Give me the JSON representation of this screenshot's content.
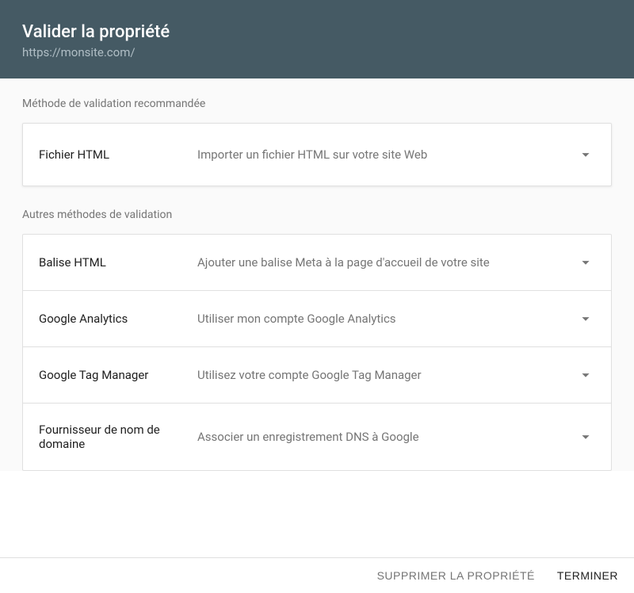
{
  "header": {
    "title": "Valider la propriété",
    "url": "https://monsite.com/"
  },
  "recommended": {
    "label": "Méthode de validation recommandée",
    "method": {
      "name": "Fichier HTML",
      "desc": "Importer un fichier HTML sur votre site Web"
    }
  },
  "other": {
    "label": "Autres méthodes de validation",
    "methods": [
      {
        "name": "Balise HTML",
        "desc": "Ajouter une balise Meta à la page d'accueil de votre site"
      },
      {
        "name": "Google Analytics",
        "desc": "Utiliser mon compte Google Analytics"
      },
      {
        "name": "Google Tag Manager",
        "desc": "Utilisez votre compte Google Tag Manager"
      },
      {
        "name": "Fournisseur de nom de domaine",
        "desc": "Associer un enregistrement DNS à Google"
      }
    ]
  },
  "footer": {
    "delete": "Supprimer la propriété",
    "done": "Terminer"
  }
}
